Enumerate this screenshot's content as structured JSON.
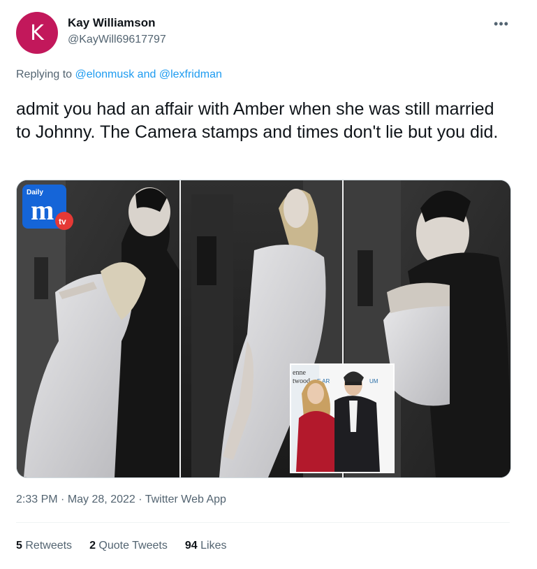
{
  "author": {
    "avatar_letter": "K",
    "avatar_color": "#c2185b",
    "name": "Kay Williamson",
    "handle": "@KayWill69617797"
  },
  "more_icon": "more-horizontal-icon",
  "reply": {
    "prefix": "Replying to",
    "mention1": "@elonmusk",
    "connector": "and",
    "mention2": "@lexfridman"
  },
  "tweet_text": "admit you had an affair with Amber when she was still married to Johnny. The Camera stamps and times don't lie but you did.",
  "media": {
    "logo_daily": "Daily",
    "logo_m": "m",
    "logo_tv": "tv",
    "inset_text1": "enne",
    "inset_text2": "twood",
    "inset_text3": "E AR",
    "inset_text4": "UM"
  },
  "meta": {
    "time": "2:33 PM",
    "sep1": "·",
    "date": "May 28, 2022",
    "sep2": "·",
    "source": "Twitter Web App"
  },
  "stats": {
    "retweets_count": "5",
    "retweets_label": "Retweets",
    "quotes_count": "2",
    "quotes_label": "Quote Tweets",
    "likes_count": "94",
    "likes_label": "Likes"
  },
  "colors": {
    "link": "#1d9bf0",
    "secondary": "#536471",
    "text": "#0f1419"
  }
}
